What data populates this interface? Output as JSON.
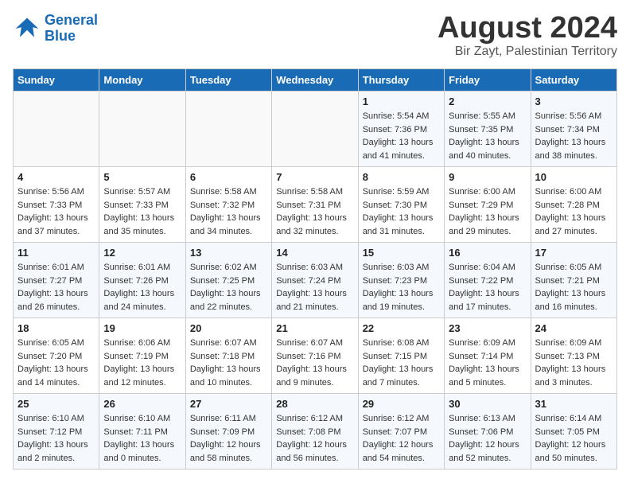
{
  "header": {
    "logo_line1": "General",
    "logo_line2": "Blue",
    "main_title": "August 2024",
    "subtitle": "Bir Zayt, Palestinian Territory"
  },
  "calendar": {
    "days_of_week": [
      "Sunday",
      "Monday",
      "Tuesday",
      "Wednesday",
      "Thursday",
      "Friday",
      "Saturday"
    ],
    "weeks": [
      [
        {
          "day": "",
          "info": ""
        },
        {
          "day": "",
          "info": ""
        },
        {
          "day": "",
          "info": ""
        },
        {
          "day": "",
          "info": ""
        },
        {
          "day": "1",
          "info": "Sunrise: 5:54 AM\nSunset: 7:36 PM\nDaylight: 13 hours\nand 41 minutes."
        },
        {
          "day": "2",
          "info": "Sunrise: 5:55 AM\nSunset: 7:35 PM\nDaylight: 13 hours\nand 40 minutes."
        },
        {
          "day": "3",
          "info": "Sunrise: 5:56 AM\nSunset: 7:34 PM\nDaylight: 13 hours\nand 38 minutes."
        }
      ],
      [
        {
          "day": "4",
          "info": "Sunrise: 5:56 AM\nSunset: 7:33 PM\nDaylight: 13 hours\nand 37 minutes."
        },
        {
          "day": "5",
          "info": "Sunrise: 5:57 AM\nSunset: 7:33 PM\nDaylight: 13 hours\nand 35 minutes."
        },
        {
          "day": "6",
          "info": "Sunrise: 5:58 AM\nSunset: 7:32 PM\nDaylight: 13 hours\nand 34 minutes."
        },
        {
          "day": "7",
          "info": "Sunrise: 5:58 AM\nSunset: 7:31 PM\nDaylight: 13 hours\nand 32 minutes."
        },
        {
          "day": "8",
          "info": "Sunrise: 5:59 AM\nSunset: 7:30 PM\nDaylight: 13 hours\nand 31 minutes."
        },
        {
          "day": "9",
          "info": "Sunrise: 6:00 AM\nSunset: 7:29 PM\nDaylight: 13 hours\nand 29 minutes."
        },
        {
          "day": "10",
          "info": "Sunrise: 6:00 AM\nSunset: 7:28 PM\nDaylight: 13 hours\nand 27 minutes."
        }
      ],
      [
        {
          "day": "11",
          "info": "Sunrise: 6:01 AM\nSunset: 7:27 PM\nDaylight: 13 hours\nand 26 minutes."
        },
        {
          "day": "12",
          "info": "Sunrise: 6:01 AM\nSunset: 7:26 PM\nDaylight: 13 hours\nand 24 minutes."
        },
        {
          "day": "13",
          "info": "Sunrise: 6:02 AM\nSunset: 7:25 PM\nDaylight: 13 hours\nand 22 minutes."
        },
        {
          "day": "14",
          "info": "Sunrise: 6:03 AM\nSunset: 7:24 PM\nDaylight: 13 hours\nand 21 minutes."
        },
        {
          "day": "15",
          "info": "Sunrise: 6:03 AM\nSunset: 7:23 PM\nDaylight: 13 hours\nand 19 minutes."
        },
        {
          "day": "16",
          "info": "Sunrise: 6:04 AM\nSunset: 7:22 PM\nDaylight: 13 hours\nand 17 minutes."
        },
        {
          "day": "17",
          "info": "Sunrise: 6:05 AM\nSunset: 7:21 PM\nDaylight: 13 hours\nand 16 minutes."
        }
      ],
      [
        {
          "day": "18",
          "info": "Sunrise: 6:05 AM\nSunset: 7:20 PM\nDaylight: 13 hours\nand 14 minutes."
        },
        {
          "day": "19",
          "info": "Sunrise: 6:06 AM\nSunset: 7:19 PM\nDaylight: 13 hours\nand 12 minutes."
        },
        {
          "day": "20",
          "info": "Sunrise: 6:07 AM\nSunset: 7:18 PM\nDaylight: 13 hours\nand 10 minutes."
        },
        {
          "day": "21",
          "info": "Sunrise: 6:07 AM\nSunset: 7:16 PM\nDaylight: 13 hours\nand 9 minutes."
        },
        {
          "day": "22",
          "info": "Sunrise: 6:08 AM\nSunset: 7:15 PM\nDaylight: 13 hours\nand 7 minutes."
        },
        {
          "day": "23",
          "info": "Sunrise: 6:09 AM\nSunset: 7:14 PM\nDaylight: 13 hours\nand 5 minutes."
        },
        {
          "day": "24",
          "info": "Sunrise: 6:09 AM\nSunset: 7:13 PM\nDaylight: 13 hours\nand 3 minutes."
        }
      ],
      [
        {
          "day": "25",
          "info": "Sunrise: 6:10 AM\nSunset: 7:12 PM\nDaylight: 13 hours\nand 2 minutes."
        },
        {
          "day": "26",
          "info": "Sunrise: 6:10 AM\nSunset: 7:11 PM\nDaylight: 13 hours\nand 0 minutes."
        },
        {
          "day": "27",
          "info": "Sunrise: 6:11 AM\nSunset: 7:09 PM\nDaylight: 12 hours\nand 58 minutes."
        },
        {
          "day": "28",
          "info": "Sunrise: 6:12 AM\nSunset: 7:08 PM\nDaylight: 12 hours\nand 56 minutes."
        },
        {
          "day": "29",
          "info": "Sunrise: 6:12 AM\nSunset: 7:07 PM\nDaylight: 12 hours\nand 54 minutes."
        },
        {
          "day": "30",
          "info": "Sunrise: 6:13 AM\nSunset: 7:06 PM\nDaylight: 12 hours\nand 52 minutes."
        },
        {
          "day": "31",
          "info": "Sunrise: 6:14 AM\nSunset: 7:05 PM\nDaylight: 12 hours\nand 50 minutes."
        }
      ]
    ]
  }
}
